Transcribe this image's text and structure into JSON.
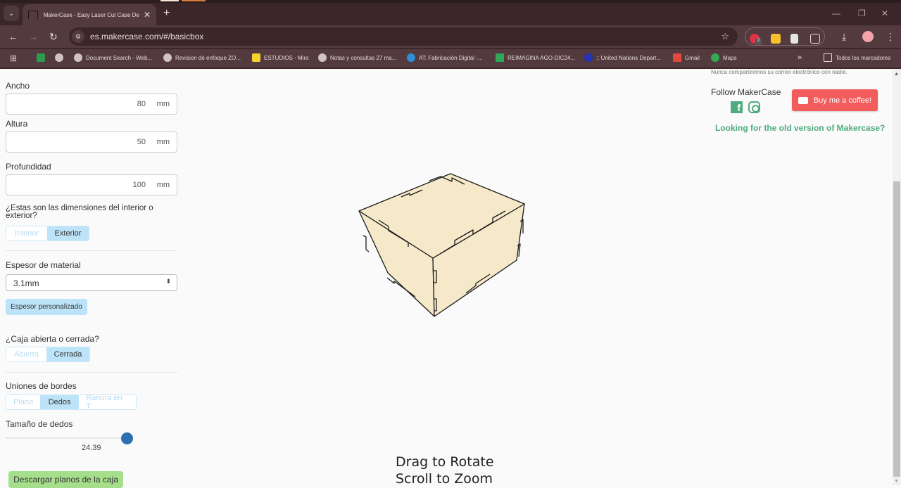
{
  "browser": {
    "tab_title": "MakerCase - Easy Laser Cut Case Design",
    "url": "es.makercase.com/#/basicbox",
    "extensions": [
      "abp-icon",
      "keep-icon",
      "document-icon",
      "puzzle-extensions-icon"
    ],
    "extension_badge": "2",
    "bookmarks": [
      {
        "label": "",
        "icon": "google-drive-icon"
      },
      {
        "label": "",
        "icon": "globe-icon"
      },
      {
        "label": "Document Search - Web...",
        "icon": "globe-icon"
      },
      {
        "label": "Revision de enfoque ZO...",
        "icon": "globe-icon"
      },
      {
        "label": "ESTUDIOS - Miro",
        "icon": "miro-icon"
      },
      {
        "label": "Notas y consultas 27 ma...",
        "icon": "globe-icon"
      },
      {
        "label": "AT: Fabricación Digital -...",
        "icon": "canva-icon"
      },
      {
        "label": "REIMAGINA AGO-DIC24...",
        "icon": "sheets-icon"
      },
      {
        "label": ":: United Nations Depart...",
        "icon": "un-icon"
      },
      {
        "label": "Gmail",
        "icon": "gmail-icon"
      },
      {
        "label": "Maps",
        "icon": "maps-icon"
      }
    ],
    "all_bookmarks": "Todos los marcadores"
  },
  "form": {
    "ancho": {
      "label": "Ancho",
      "value": "80",
      "unit": "mm"
    },
    "altura": {
      "label": "Altura",
      "value": "50",
      "unit": "mm"
    },
    "profundidad": {
      "label": "Profundidad",
      "value": "100",
      "unit": "mm"
    },
    "dimensions_question": "¿Estas son las dimensiones del interior o exterior?",
    "dimensions_options": [
      "Interior",
      "Exterior"
    ],
    "dimensions_selected": "Exterior",
    "thickness_label": "Espesor de material",
    "thickness_value": "3.1mm",
    "custom_thickness": "Espesor personalizado",
    "open_closed_question": "¿Caja abierta o cerrada?",
    "open_closed_options": [
      "Abierta",
      "Cerrada"
    ],
    "open_closed_selected": "Cerrada",
    "joints_label": "Uniones de bordes",
    "joints_options": [
      "Plano",
      "Dedos",
      "Ranura en T"
    ],
    "joints_selected": "Dedos",
    "finger_size_label": "Tamaño de dedos",
    "finger_size_value": "24.39",
    "finger_size_fraction": 1.0,
    "download_button": "Descargar planos de la caja"
  },
  "viewer": {
    "hint_rotate": "Drag to Rotate",
    "hint_zoom": "Scroll to Zoom",
    "box_color": "#f5e9c9"
  },
  "right": {
    "privacy_note": "Nunca compartiremos su correo electrónico con nadie.",
    "follow": "Follow MakerCase",
    "coffee_button": "Buy me a coffee!",
    "old_version_link": "Looking for the old version of Makercase?"
  }
}
